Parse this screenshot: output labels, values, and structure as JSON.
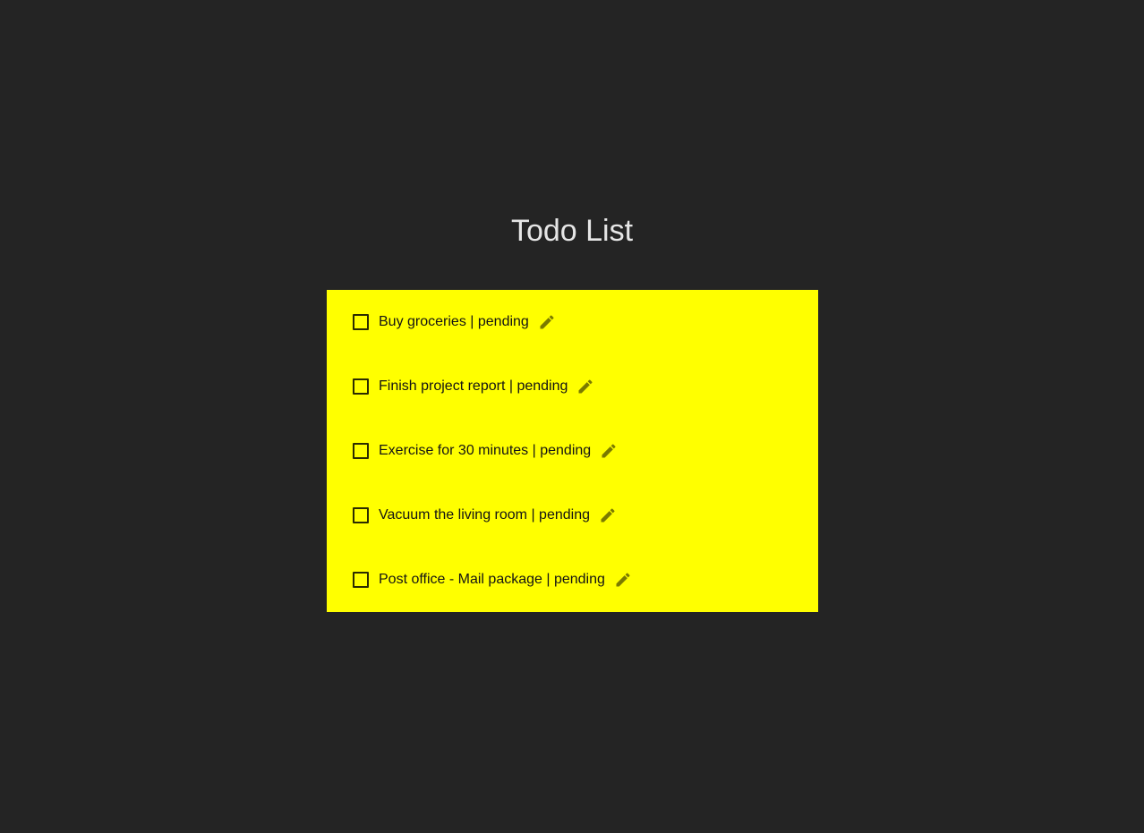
{
  "header": {
    "title": "Todo List"
  },
  "todos": [
    {
      "text": "Buy groceries | pending",
      "checked": false,
      "icon": "pencil-icon"
    },
    {
      "text": "Finish project report | pending",
      "checked": false,
      "icon": "pencil-icon"
    },
    {
      "text": "Exercise for 30 minutes | pending",
      "checked": false,
      "icon": "pencil-icon"
    },
    {
      "text": "Vacuum the living room | pending",
      "checked": false,
      "icon": "pencil-icon"
    },
    {
      "text": "Post office - Mail package | pending",
      "checked": false,
      "icon": "pencil-icon"
    }
  ],
  "colors": {
    "background": "#242424",
    "list_background": "#ffff00",
    "title_text": "#e6e6e6",
    "item_text": "#141414",
    "icon": "#7a7a00"
  }
}
